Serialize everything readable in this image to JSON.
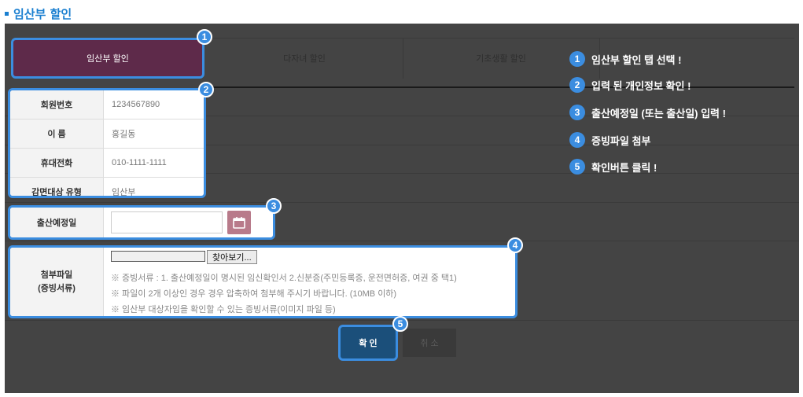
{
  "page_title": "임산부 할인",
  "tabs": [
    {
      "label": "임산부 할인",
      "active": true
    },
    {
      "label": "다자녀 할인",
      "active": false
    },
    {
      "label": "기초생활 할인",
      "active": false
    }
  ],
  "member_info": [
    {
      "label": "회원번호",
      "value": "1234567890"
    },
    {
      "label": "이 름",
      "value": "홍길동"
    },
    {
      "label": "휴대전화",
      "value": "010-1111-1111"
    },
    {
      "label": "감면대상 유형",
      "value": "임산부"
    }
  ],
  "due_date": {
    "label": "출산예정일",
    "value": ""
  },
  "attachment": {
    "label_line1": "첨부파일",
    "label_line2": "(증빙서류)",
    "browse_label": "찾아보기...",
    "notes": [
      "※ 증빙서류 : 1. 출산예정일이 명시된 임신확인서 2.신분증(주민등록증, 운전면허증, 여권 중 택1)",
      "※ 파일이 2개 이상인 경우 경우 압축하여 첨부해 주시기 바랍니다. (10MB 이하)",
      "※ 임산부 대상자임을 확인할 수 있는 증빙서류(이미지 파일 등)"
    ]
  },
  "buttons": {
    "confirm": "확 인",
    "cancel": "취 소"
  },
  "badges": [
    "1",
    "2",
    "3",
    "4",
    "5"
  ],
  "guide": [
    {
      "num": "1",
      "text": "임산부 할인 탭 선택 !"
    },
    {
      "num": "2",
      "text": "입력 된 개인정보 확인 !"
    },
    {
      "num": "3",
      "text": "출산예정일 (또는 출산일) 입력 !"
    },
    {
      "num": "4",
      "text": "증빙파일 첨부"
    },
    {
      "num": "5",
      "text": "확인버튼 클릭 !"
    }
  ],
  "colors": {
    "accent": "#3b8de0",
    "title": "#1a7fd0",
    "active_tab": "#5e2a4a",
    "calendar": "#b87a8a",
    "confirm": "#1b4f7a"
  },
  "icons": {
    "calendar": "calendar-icon"
  }
}
